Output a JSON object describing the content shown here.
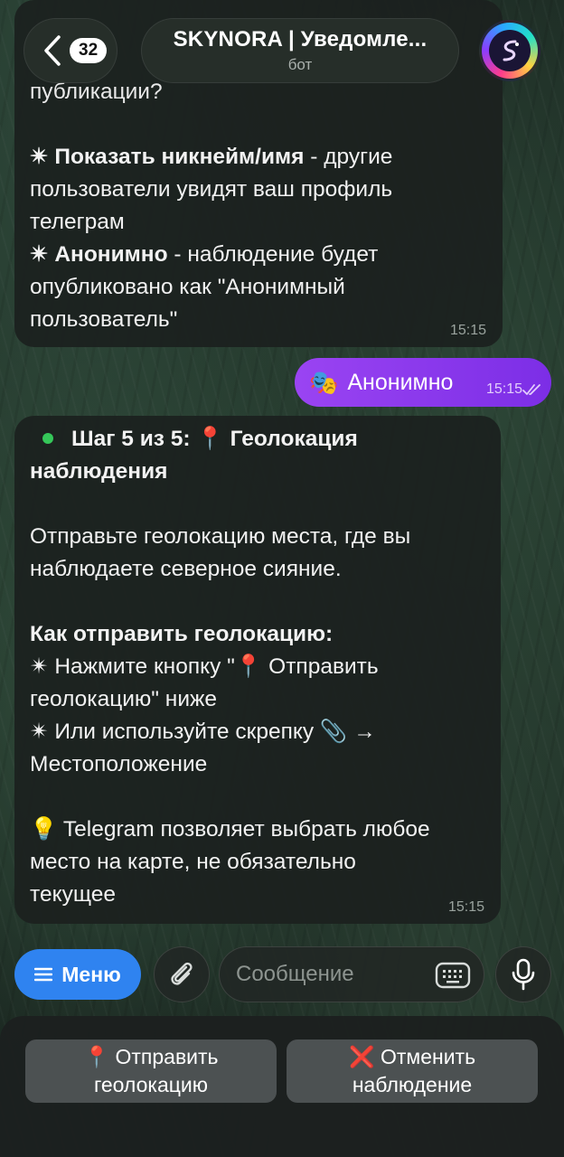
{
  "header": {
    "unread_count": "32",
    "title": "SKYNORA | Уведомле...",
    "subtitle": "бот"
  },
  "messages": {
    "first": {
      "cut_line": "публикации?",
      "opt1_bold": "✴ Показать никнейм/имя",
      "opt1_rest": " - другие",
      "opt1_l2": "пользователи увидят ваш профиль",
      "opt1_l3": "телеграм",
      "opt2_bold": "✴ Анонимно",
      "opt2_rest": " - наблюдение будет",
      "opt2_l2": "опубликовано как \"Анонимный",
      "opt2_l3": "пользователь\"",
      "time": "15:15"
    },
    "outgoing": {
      "emoji": "🎭",
      "text": "Анонимно",
      "time": "15:15"
    },
    "second": {
      "step_title": "Шаг 5 из 5: 📍 Геолокация",
      "step_title_l2": "наблюдения",
      "p1_l1": "Отправьте геолокацию места, где вы",
      "p1_l2": "наблюдаете северное сияние.",
      "how_title": "Как отправить геолокацию:",
      "how_l1": "✴ Нажмите кнопку \"📍 Отправить",
      "how_l2": "геолокацию\" ниже",
      "how_l3": "✴ Или используйте скрепку 📎 →",
      "how_l4": "Местоположение",
      "tip_l1": "💡 Telegram позволяет выбрать любое",
      "tip_l2": "место на карте, не обязательно",
      "tip_l3": "текущее",
      "time": "15:15"
    }
  },
  "input_bar": {
    "menu_label": "Меню",
    "placeholder": "Сообщение"
  },
  "keyboard": {
    "send_location_l1": "📍 Отправить",
    "send_location_l2": "геолокацию",
    "cancel_l1": "❌ Отменить",
    "cancel_l2": "наблюдение"
  },
  "colors": {
    "accent_blue": "#2f83f0",
    "outgoing_purple": "#8a3aec",
    "status_green": "#35c759"
  },
  "icons": [
    "back-chevron-icon",
    "bot-avatar-icon",
    "double-check-icon",
    "menu-icon",
    "paperclip-icon",
    "keyboard-icon",
    "microphone-icon"
  ]
}
